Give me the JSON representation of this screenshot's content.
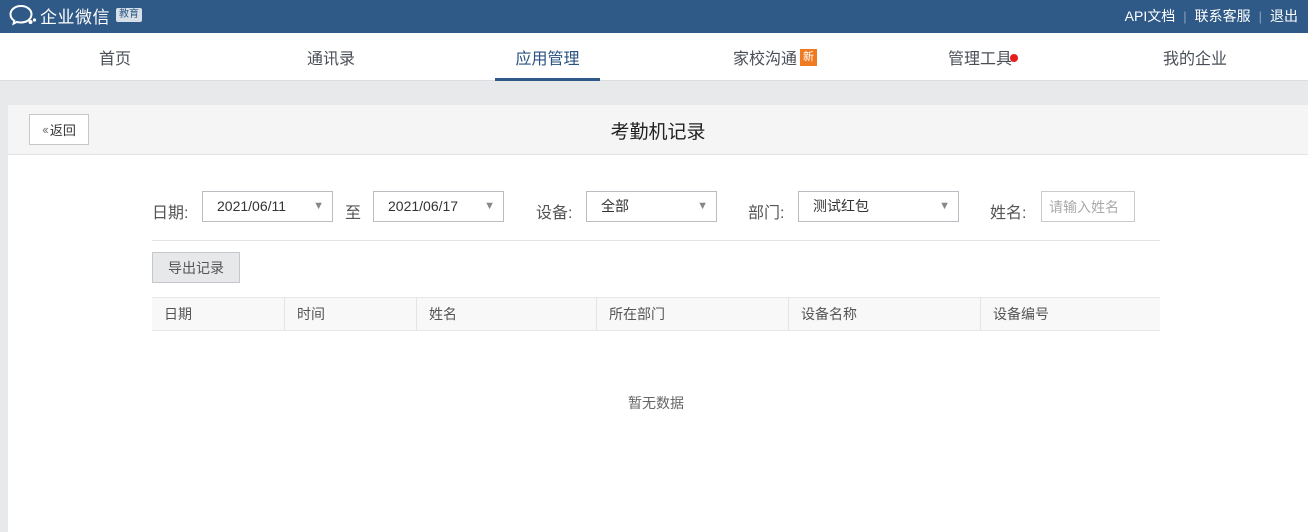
{
  "topbar": {
    "logo_text": "企业微信",
    "logo_badge": "教育",
    "links": [
      "API文档",
      "联系客服",
      "退出"
    ]
  },
  "nav": {
    "items": [
      "首页",
      "通讯录",
      "应用管理",
      "家校沟通",
      "管理工具",
      "我的企业"
    ],
    "active_index": 2,
    "new_badge": "新"
  },
  "panel": {
    "back_label": "返回",
    "title": "考勤机记录"
  },
  "filters": {
    "date_label": "日期:",
    "date_from": "2021/06/11",
    "to_label": "至",
    "date_to": "2021/06/17",
    "device_label": "设备:",
    "device_value": "全部",
    "dept_label": "部门:",
    "dept_value": "测试红包",
    "name_label": "姓名:",
    "name_placeholder": "请输入姓名",
    "name_value": ""
  },
  "export_label": "导出记录",
  "table": {
    "columns": [
      "日期",
      "时间",
      "姓名",
      "所在部门",
      "设备名称",
      "设备编号"
    ],
    "rows": [],
    "empty_text": "暂无数据"
  },
  "colors": {
    "topbar": "#2f5987",
    "accent": "#2a5282",
    "new_badge": "#f07a22",
    "notify_dot": "#e61c1c"
  }
}
